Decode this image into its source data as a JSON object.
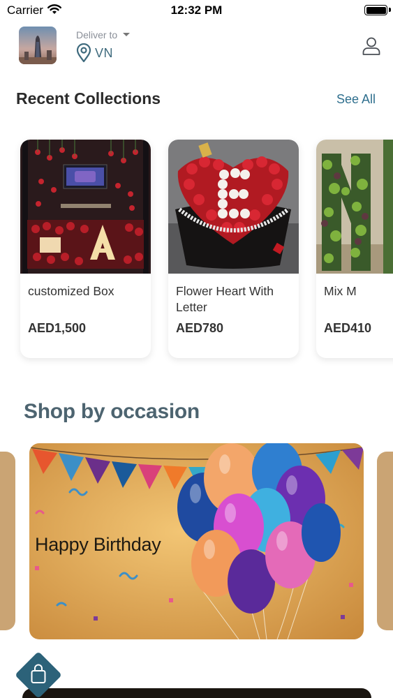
{
  "status_bar": {
    "carrier": "Carrier",
    "time": "12:32 PM"
  },
  "header": {
    "deliver_label": "Deliver to",
    "location_code": "VN",
    "icons": [
      "store-thumbnail",
      "chevron-down-icon",
      "location-pin-icon",
      "user-profile-icon"
    ]
  },
  "recent": {
    "title": "Recent Collections",
    "see_all": "See All",
    "items": [
      {
        "name": "customized Box",
        "price": "AED1,500"
      },
      {
        "name": "Flower Heart With Letter",
        "price": "AED780"
      },
      {
        "name": "Mix M",
        "price": "AED410"
      }
    ]
  },
  "occasion": {
    "title": "Shop by occasion",
    "banners": [
      {
        "label": "Happy Birthday"
      }
    ]
  },
  "colors": {
    "accent": "#2f6f8e",
    "occasion_title": "#4d6470",
    "banner_bg": "#d8a55a",
    "card_bg": "#ffffff",
    "cart_fab": "#2c6279"
  }
}
